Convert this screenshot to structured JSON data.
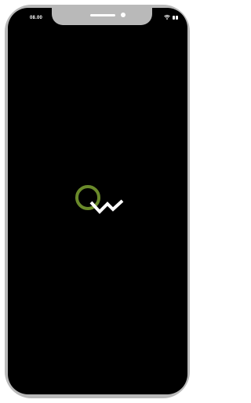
{
  "status_bar": {
    "time": "08.00",
    "icons": [
      "wifi-icon",
      "battery-icon"
    ]
  },
  "splash": {
    "logo_icon": "qw-logo-icon"
  },
  "colors": {
    "frame": "#b9b9b9",
    "screen": "#000000",
    "logo_green": "#6a8a2a",
    "logo_white": "#ffffff"
  }
}
